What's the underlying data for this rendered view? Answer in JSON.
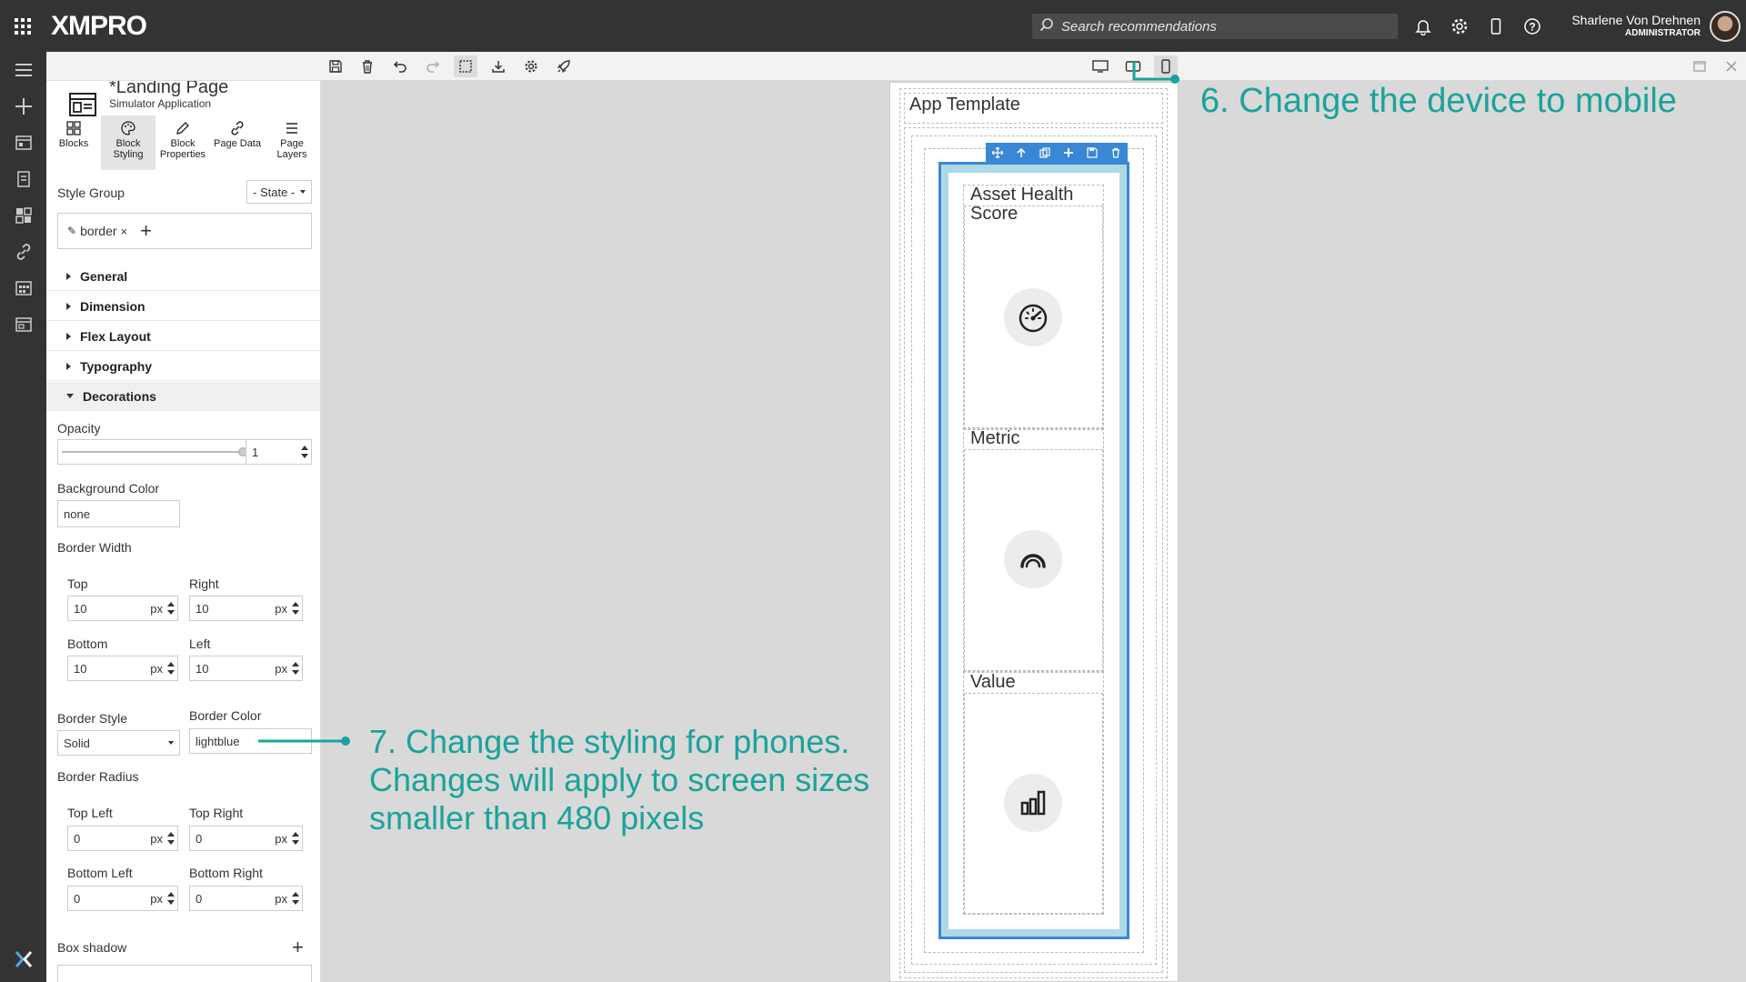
{
  "app": {
    "logo": "XMPRO",
    "search_placeholder": "Search recommendations",
    "user_name": "Sharlene Von Drehnen",
    "user_role": "ADMINISTRATOR"
  },
  "page": {
    "title": "*Landing Page",
    "subtitle": "Simulator Application"
  },
  "tabs": [
    {
      "label": "Blocks",
      "icon": "blocks-icon"
    },
    {
      "label": "Block Styling",
      "icon": "palette-icon"
    },
    {
      "label": "Block Properties",
      "icon": "pencil-icon"
    },
    {
      "label": "Page Data",
      "icon": "link-icon"
    },
    {
      "label": "Page Layers",
      "icon": "layers-icon"
    }
  ],
  "style_group": {
    "label": "Style Group",
    "state_value": "- State -",
    "tag": "border"
  },
  "sections": [
    "General",
    "Dimension",
    "Flex Layout",
    "Typography",
    "Decorations"
  ],
  "decorations": {
    "opacity_label": "Opacity",
    "opacity_value": "1",
    "opacity_level": 1,
    "bg_label": "Background Color",
    "bg_value": "none",
    "border_width_label": "Border Width",
    "top_label": "Top",
    "top_value": "10",
    "right_label": "Right",
    "right_value": "10",
    "bottom_label": "Bottom",
    "bottom_value": "10",
    "left_label": "Left",
    "left_value": "10",
    "unit": "px",
    "border_style_label": "Border Style",
    "border_style_value": "Solid",
    "border_color_label": "Border Color",
    "border_color_value": "lightblue",
    "border_radius_label": "Border Radius",
    "tl_label": "Top Left",
    "tl_value": "0",
    "tr_label": "Top Right",
    "tr_value": "0",
    "bl_label": "Bottom Left",
    "bl_value": "0",
    "br_label": "Bottom Right",
    "br_value": "0",
    "box_shadow_label": "Box shadow"
  },
  "canvas": {
    "template_title": "App Template",
    "cards": [
      {
        "title": "Asset Health Score",
        "icon": "gauge-icon"
      },
      {
        "title": "Metric",
        "icon": "arc-gauge-icon"
      },
      {
        "title": "Value",
        "icon": "bar-chart-icon"
      }
    ]
  },
  "annotations": {
    "step6": "6. Change the device to mobile",
    "step7": "7. Change the styling for phones. Changes will apply to screen sizes smaller than 480 pixels"
  },
  "colors": {
    "accent": "#1aa39a",
    "selection": "#3a87d6",
    "border_preview": "#add8e6"
  }
}
